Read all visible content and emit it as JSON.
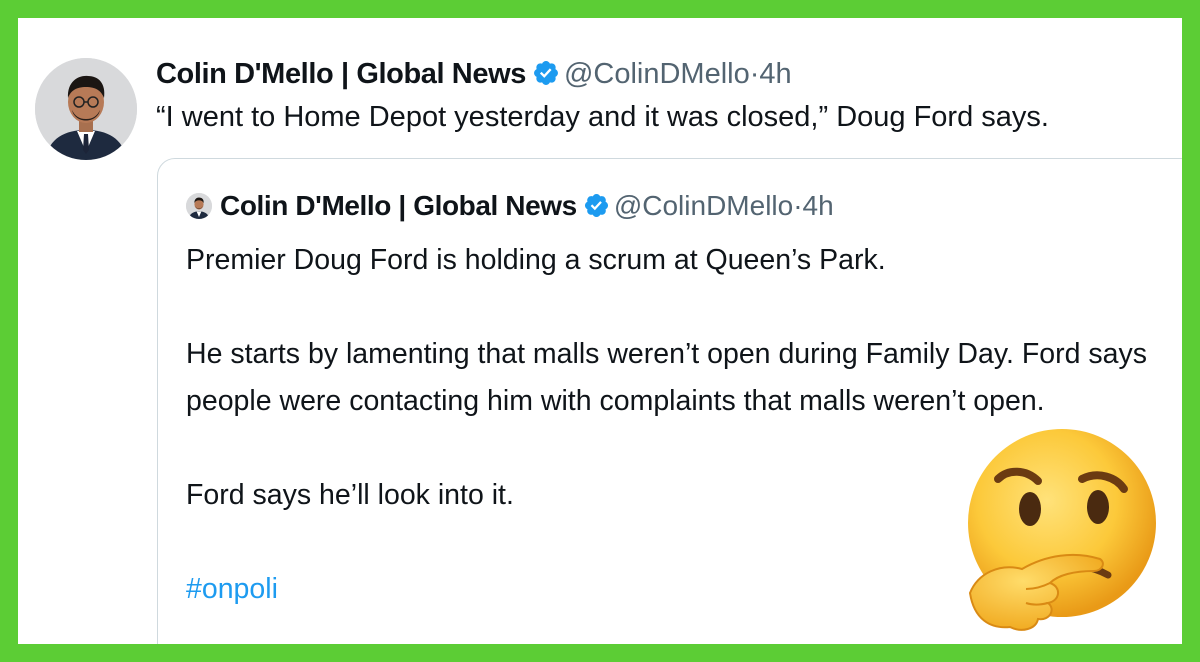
{
  "tweet": {
    "author_name": "Colin D'Mello | Global News",
    "handle": "@ColinDMello",
    "separator": "·",
    "time": "4h",
    "text": "“I went to Home Depot yesterday and it was closed,” Doug Ford says."
  },
  "quoted_tweet": {
    "author_name": "Colin D'Mello | Global News",
    "handle": "@ColinDMello",
    "separator": "·",
    "time": "4h",
    "paragraphs": [
      "Premier Doug Ford is holding a scrum at Queen’s Park.",
      "He starts by lamenting that malls weren’t open during Family Day. Ford says people were contacting him with complaints that malls weren’t open.",
      "Ford says he’ll look into it."
    ],
    "hashtag": "#onpoli"
  },
  "colors": {
    "frame_green": "#5ccd35",
    "verified_blue": "#1d9bf0",
    "text_primary": "#0f1419",
    "text_secondary": "#536471"
  },
  "icons": {
    "verified": "verified-badge-icon",
    "emoji": "thinking-face-emoji"
  }
}
